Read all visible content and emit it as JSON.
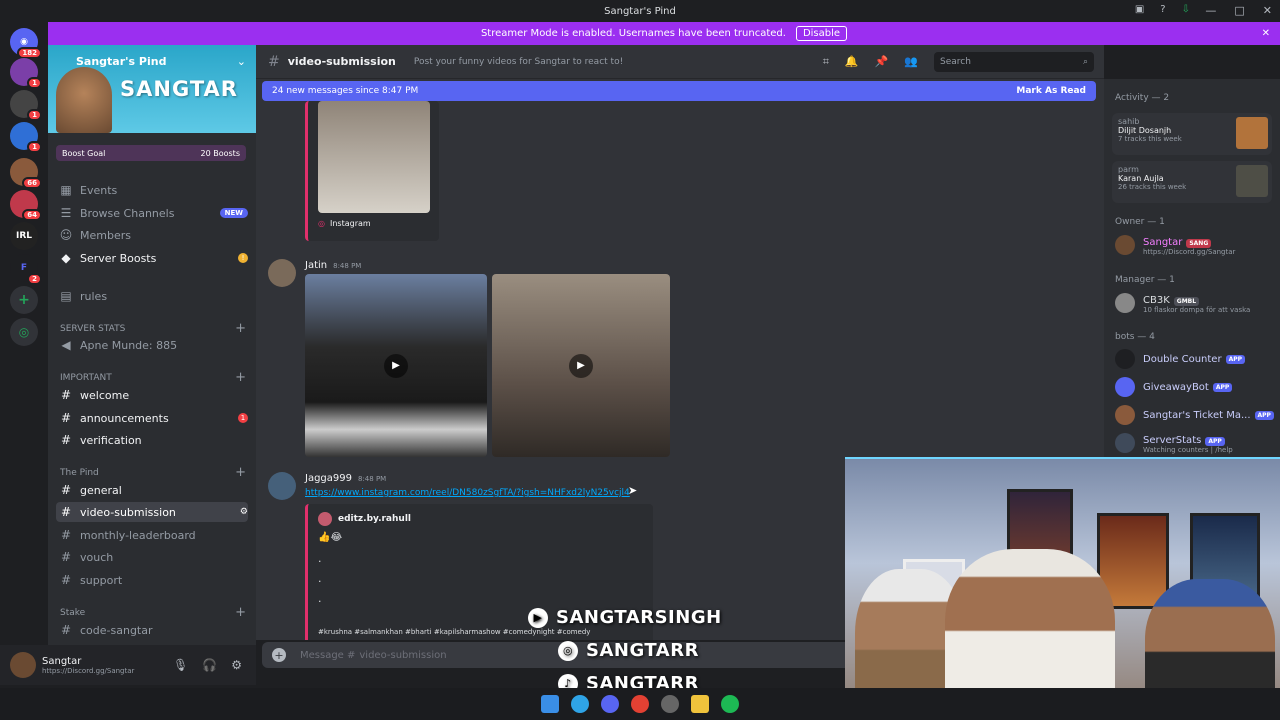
{
  "window": {
    "title": "Sangtar's Pind"
  },
  "streamer_bar": {
    "text": "Streamer Mode is enabled. Usernames have been truncated.",
    "button": "Disable"
  },
  "guilds": [
    {
      "label": "",
      "badge": "182"
    },
    {
      "label": "",
      "badge": "1"
    },
    {
      "label": "",
      "badge": "1"
    },
    {
      "label": "",
      "badge": "1"
    },
    {
      "label": "",
      "badge": "66"
    },
    {
      "label": "",
      "badge": "64"
    },
    {
      "label": "IRL",
      "badge": ""
    },
    {
      "label": "F",
      "badge": "2"
    }
  ],
  "server": {
    "name": "Sangtar's Pind",
    "banner_text": "SANGTAR",
    "boost_goal": "Boost Goal",
    "boosts": "20 Boosts"
  },
  "sidebar": {
    "top_items": [
      {
        "icon": "calendar-icon",
        "label": "Events"
      },
      {
        "icon": "browse-icon",
        "label": "Browse Channels",
        "badge": "NEW"
      },
      {
        "icon": "members-icon",
        "label": "Members"
      },
      {
        "icon": "boost-icon",
        "label": "Server Boosts"
      }
    ],
    "rules": "rules",
    "cat_stats": "SERVER STATS",
    "stat_channel": "Apne Munde: 885",
    "cat_important": "IMPORTANT",
    "important": [
      {
        "label": "welcome"
      },
      {
        "label": "announcements",
        "badge": "1"
      },
      {
        "label": "verification"
      }
    ],
    "cat_pind": "The Pind",
    "pind": [
      {
        "label": "general"
      },
      {
        "label": "video-submission"
      },
      {
        "label": "monthly-leaderboard"
      },
      {
        "label": "vouch"
      },
      {
        "label": "support"
      }
    ],
    "cat_stake": "Stake",
    "stake": [
      {
        "label": "code-sangtar"
      }
    ]
  },
  "user": {
    "name": "Sangtar",
    "sub": "https://Discord.gg/Sangtar"
  },
  "channel": {
    "name": "video-submission",
    "topic": "Post your funny videos for Sangtar to react to!"
  },
  "search": {
    "placeholder": "Search"
  },
  "new_messages": {
    "text": "24 new messages since 8:47 PM",
    "action": "Mark As Read"
  },
  "messages": [
    {
      "embed_source": "Instagram"
    },
    {
      "author": "Jatin",
      "time": "8:48 PM"
    },
    {
      "author": "Jagga999",
      "time": "8:48 PM",
      "link": "https://www.instagram.com/reel/DN580zSgfTA/?igsh=NHFxd2lyN25vcjl4",
      "embed_author": "editz.by.rahull",
      "embed_emoji": "👍😂",
      "embed_dots": ".",
      "embed_tags": "#krushna #salmankhan #bharti #kapilsharmashow #comedynight #comedy"
    }
  ],
  "composer": {
    "placeholder": "Message #",
    "channel": "video-submission"
  },
  "members": {
    "activity": "Activity — 2",
    "activities": [
      {
        "user": "sahib",
        "artist": "Diljit Dosanjh",
        "tracks": "7 tracks this week"
      },
      {
        "user": "parm",
        "artist": "Karan Aujla",
        "tracks": "26 tracks this week"
      }
    ],
    "owner_header": "Owner — 1",
    "owner": {
      "name": "Sangtar",
      "tag": "SANG",
      "sub": "https://Discord.gg/Sangtar"
    },
    "manager_header": "Manager — 1",
    "manager": {
      "name": "CB3K",
      "tag": "GMBL",
      "sub": "10 flaskor dompa för att vaska"
    },
    "bots_header": "bots — 4",
    "bots": [
      {
        "name": "Double Counter",
        "tag": "APP"
      },
      {
        "name": "GiveawayBot",
        "tag": "APP"
      },
      {
        "name": "Sangtar's Ticket Ma...",
        "tag": "APP"
      },
      {
        "name": "ServerStats",
        "tag": "APP",
        "sub": "Watching counters | /help"
      }
    ]
  },
  "watermark": [
    "SANGTARSINGH",
    "SANGTARR",
    "SANGTARR"
  ]
}
